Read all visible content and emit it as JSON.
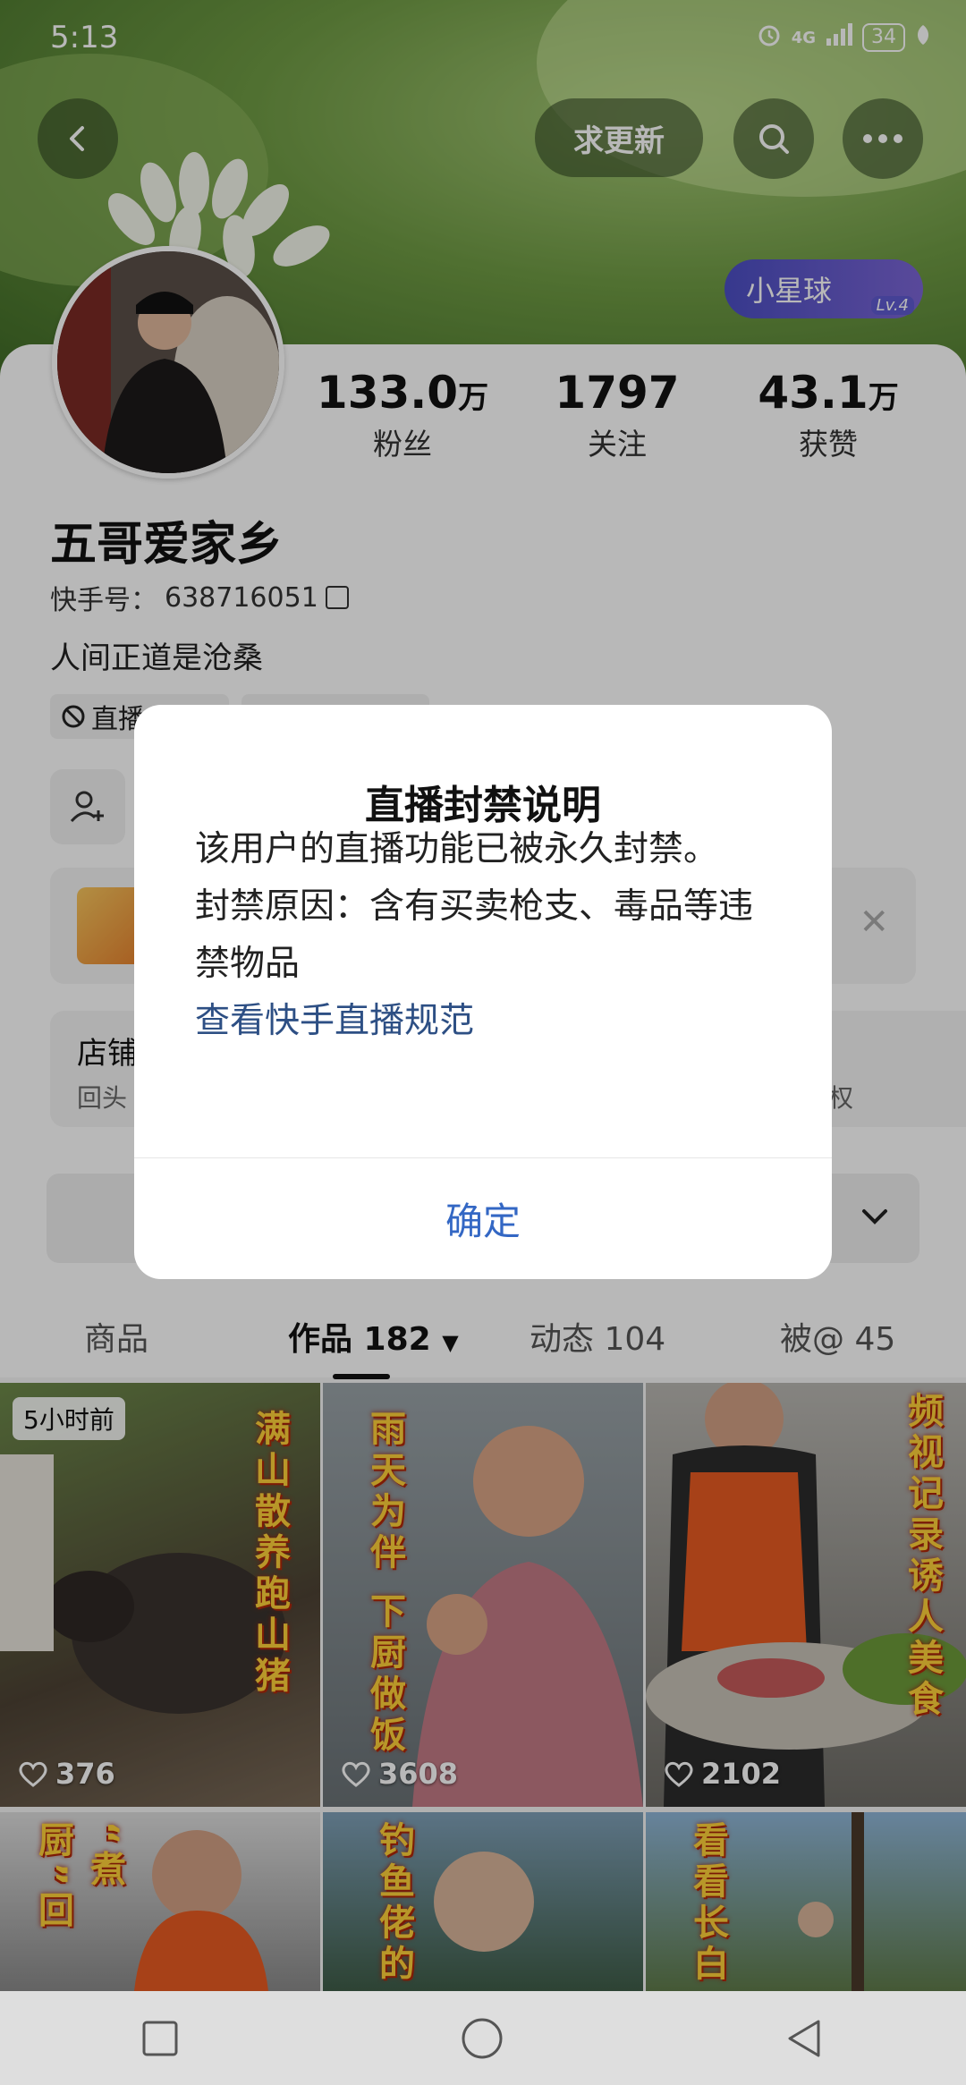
{
  "status_bar": {
    "time": "5:13",
    "network": "4G",
    "battery": "34"
  },
  "header": {
    "refresh_request_label": "求更新"
  },
  "planet_badge": {
    "label": "小星球",
    "level": "Lv.4"
  },
  "stats": [
    {
      "number": "133.0",
      "unit": "万",
      "label": "粉丝"
    },
    {
      "number": "1797",
      "unit": "",
      "label": "关注"
    },
    {
      "number": "43.1",
      "unit": "万",
      "label": "获赞"
    }
  ],
  "profile": {
    "nickname": "五哥爱家乡",
    "kwai_id_label": "快手号：",
    "kwai_id": "638716051",
    "bio": "人间正道是沧桑",
    "tag_1": "直播",
    "shop_title": "店铺",
    "shop_sub": "回头",
    "shop_tail": "权"
  },
  "dialog": {
    "title": "直播封禁说明",
    "line_1": "该用户的直播功能已被永久封禁。",
    "line_2": "封禁原因：含有买卖枪支、毒品等违禁物品",
    "link": "查看快手直播规范",
    "confirm": "确定"
  },
  "tabs": [
    {
      "label": "商品"
    },
    {
      "label": "作品 182"
    },
    {
      "label": "动态 104"
    },
    {
      "label": "被@ 45"
    }
  ],
  "videos": [
    {
      "caption": "满山散养跑山猪",
      "likes": "376",
      "badge": "5小时前"
    },
    {
      "caption": "雨天为伴 下厨做饭",
      "likes": "3608"
    },
    {
      "caption": "频视记录诱人美食",
      "likes": "2102"
    },
    {
      "caption": "“煮厨”回",
      "likes": ""
    },
    {
      "caption": "钓鱼佬的",
      "likes": ""
    },
    {
      "caption": "看看长白",
      "likes": ""
    }
  ],
  "colors": {
    "accent_link": "#2d4f84",
    "confirm_blue": "#3367c4",
    "caption_yellow": "#ffd23a",
    "planet_purple": "#4c4fc4"
  }
}
